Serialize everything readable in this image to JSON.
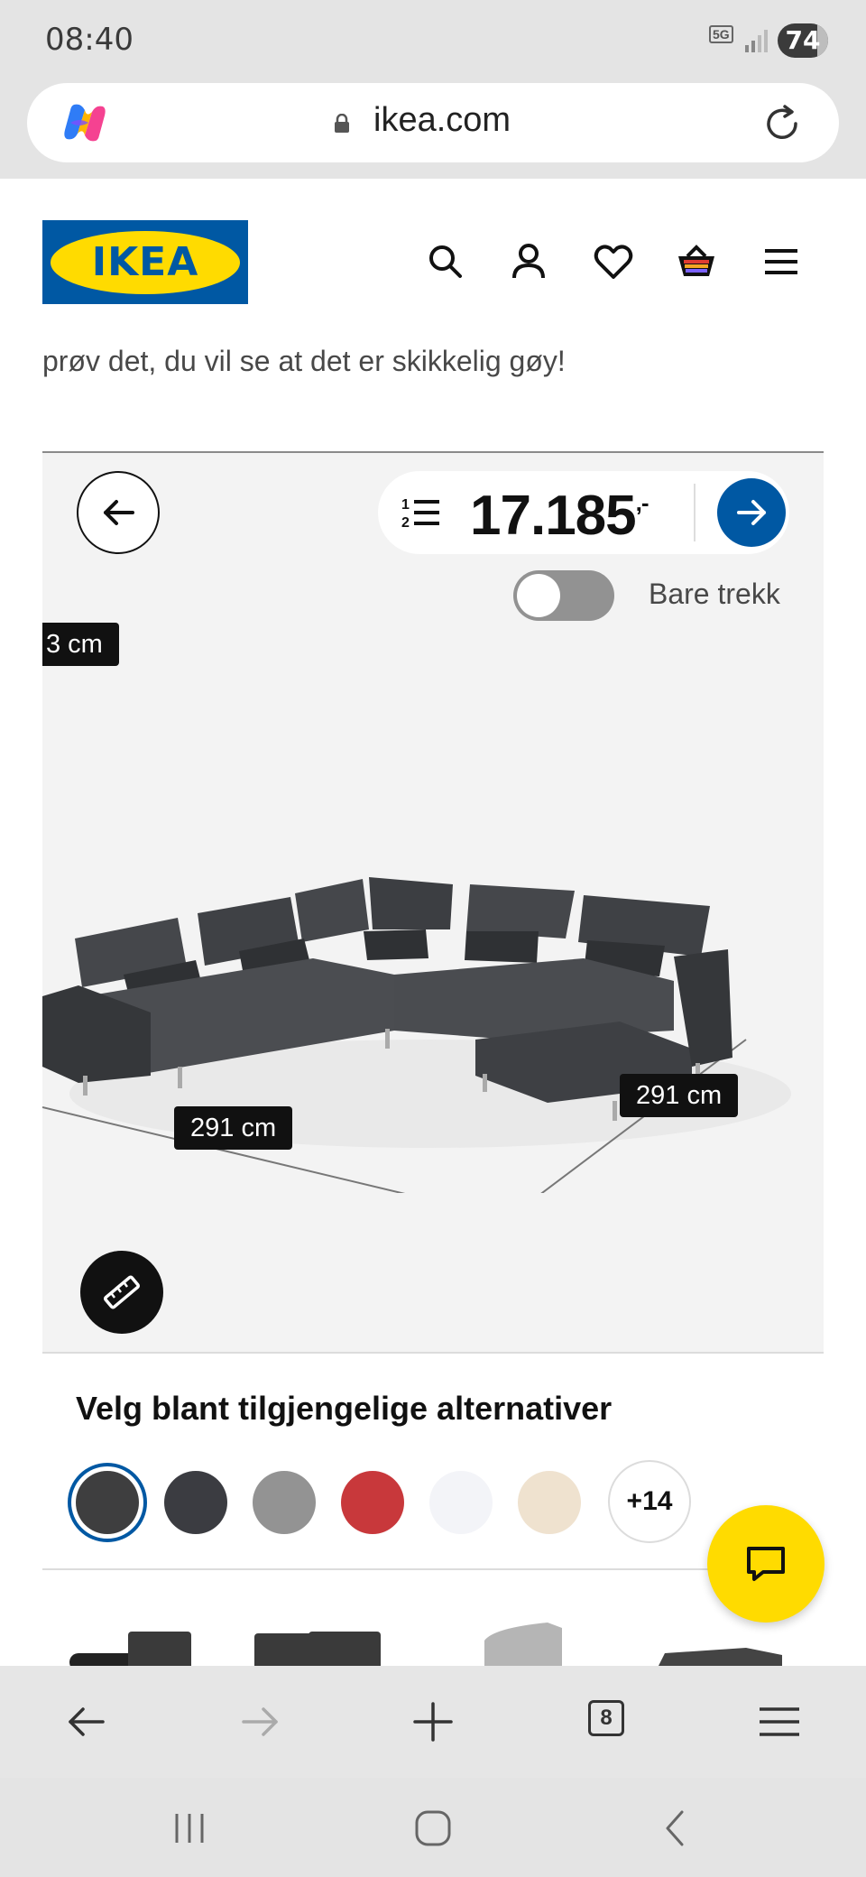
{
  "status_bar": {
    "time": "08:40",
    "network": "5G",
    "battery": "74"
  },
  "browser": {
    "url": "ikea.com",
    "tab_count": "8",
    "icons": [
      "copilot-icon",
      "lock-icon",
      "reload-icon",
      "back-arrow-icon",
      "forward-arrow-icon",
      "new-tab-icon",
      "tabs-icon",
      "menu-icon"
    ]
  },
  "site_header": {
    "logo_text": "IKEA",
    "icons": [
      "search-icon",
      "user-icon",
      "heart-icon",
      "basket-icon",
      "hamburger-menu-icon"
    ],
    "brand_colors": {
      "blue": "#0058a3",
      "yellow": "#ffdb00"
    }
  },
  "intro_text": "prøv det, du vil se at det er skikkelig gøy!",
  "configurator": {
    "price_main": "17.185",
    "price_suffix": ",-",
    "toggle_label": "Bare trekk",
    "toggle_on": false,
    "dimension_left_partial": "3 cm",
    "dimension_front": "291 cm",
    "dimension_right": "291 cm"
  },
  "options": {
    "title": "Velg blant tilgjengelige alternativer",
    "swatch_colors": [
      "#3e3e3f",
      "#3b3c41",
      "#939393",
      "#c8383b",
      "#f3f4f8",
      "#efe2cf"
    ],
    "selected_index": 0,
    "more_label": "+14"
  }
}
